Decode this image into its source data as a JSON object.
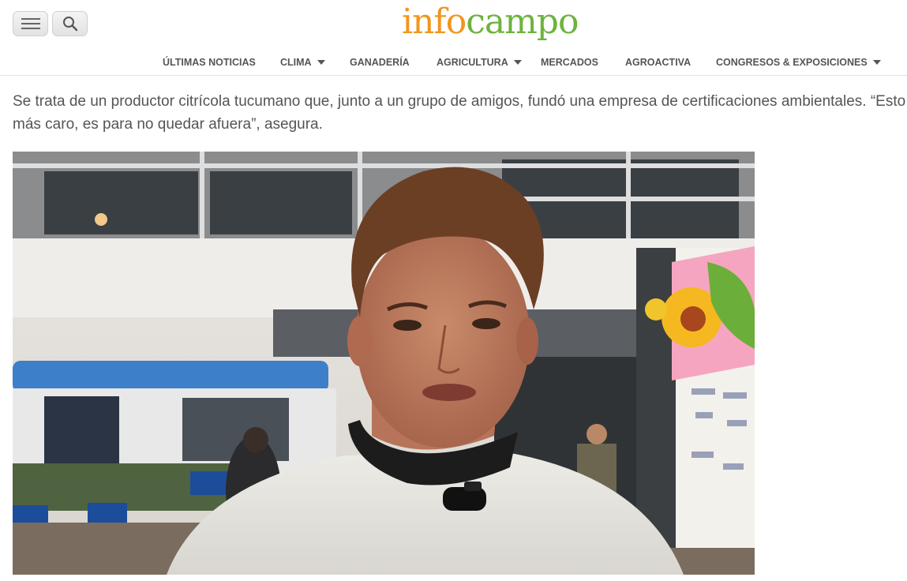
{
  "header": {
    "logo_part1": "info",
    "logo_part2": "campo"
  },
  "nav": {
    "items": [
      {
        "label": "Últimas noticias",
        "dropdown": false
      },
      {
        "label": "Clima",
        "dropdown": true
      },
      {
        "label": "Ganadería",
        "dropdown": false
      },
      {
        "label": "Agricultura",
        "dropdown": true
      },
      {
        "label": "Mercados",
        "dropdown": false
      },
      {
        "label": "Agroactiva",
        "dropdown": false
      },
      {
        "label": "Congresos & Exposiciones",
        "dropdown": true
      }
    ]
  },
  "article": {
    "lead_line1": "Se trata de un productor citrícola tucumano que, junto a un grupo de amigos, fundó una empresa de certificaciones ambientales. “Esto no es",
    "lead_line2": "más caro, es para no quedar afuera”, asegura."
  },
  "colors": {
    "logo_orange": "#f2951d",
    "logo_green": "#6db33f"
  },
  "icons": {
    "menu": "hamburger-icon",
    "search": "search-icon"
  }
}
